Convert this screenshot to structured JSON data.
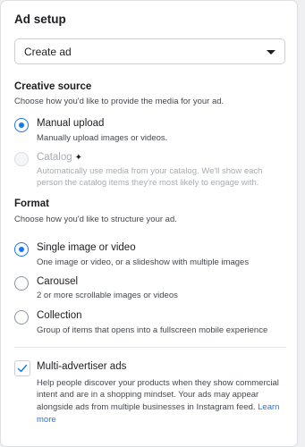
{
  "ad_setup": {
    "title": "Ad setup",
    "select_value": "Create ad"
  },
  "creative_source": {
    "heading": "Creative source",
    "subtitle": "Choose how you'd like to provide the media for your ad.",
    "options": [
      {
        "label": "Manual upload",
        "desc": [
          "Manually upload images or videos."
        ],
        "selected": true,
        "disabled": false
      },
      {
        "label": "Catalog",
        "desc": [
          "Automatically use media from your catalog. We'll show each",
          "person the catalog items they're most likely to engage with."
        ],
        "selected": false,
        "disabled": true,
        "icon": "sparkle-icon"
      }
    ]
  },
  "format": {
    "heading": "Format",
    "subtitle": "Choose how you'd like to structure your ad.",
    "options": [
      {
        "label": "Single image or video",
        "desc": [
          "One image or video, or a slideshow with multiple images"
        ],
        "selected": true
      },
      {
        "label": "Carousel",
        "desc": [
          "2 or more scrollable images or videos"
        ],
        "selected": false
      },
      {
        "label": "Collection",
        "desc": [
          "Group of items that opens into a fullscreen mobile experience"
        ],
        "selected": false
      }
    ]
  },
  "multi_advertiser": {
    "label": "Multi-advertiser ads",
    "checked": true,
    "desc": [
      "Help people discover your products when they show commercial",
      "intent and are in a shopping mindset. Your ads may appear",
      "alongside ads from multiple businesses in Instagram feed."
    ],
    "link_line1": "Learn",
    "link_line2": "more"
  },
  "colors": {
    "accent": "#1877f2",
    "text": "#1c1e21",
    "muted": "#444950",
    "disabled": "#a8acb2"
  }
}
